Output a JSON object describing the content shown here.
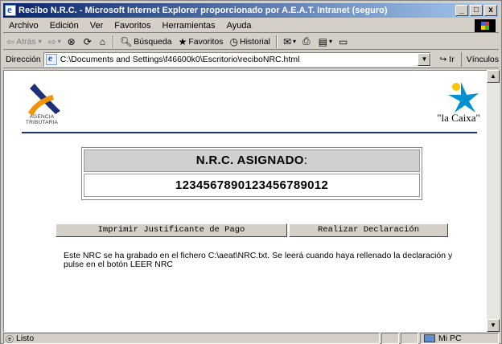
{
  "window": {
    "title": "Recibo N.R.C. - Microsoft Internet Explorer proporcionado por A.E.A.T.  Intranet (seguro)",
    "controls": [
      "_",
      "□",
      "x"
    ]
  },
  "menubar": {
    "items": [
      "Archivo",
      "Edición",
      "Ver",
      "Favoritos",
      "Herramientas",
      "Ayuda"
    ]
  },
  "toolbar": {
    "back": "Atrás",
    "search": "Búsqueda",
    "favorites": "Favoritos",
    "history": "Historial"
  },
  "addressbar": {
    "label": "Dirección",
    "url": "C:\\Documents and Settings\\f46600k0\\Escritorio\\reciboNRC.html",
    "go": "Ir",
    "links": "Vínculos"
  },
  "page": {
    "aeat_logo_text": "AGENCIA TRIBUTARIA",
    "caixa_logo_text": "\"la Caixa\"",
    "nrc_heading": "N.R.C. ASIGNADO",
    "nrc_heading_colon": ":",
    "nrc_value": "1234567890123456789012",
    "print_button": "Imprimir Justificante de Pago",
    "declaration_button": "Realizar Declaración",
    "message": "Este NRC se ha grabado en el fichero C:\\aeat\\NRC.txt. Se leerá cuando haya rellenado la declaración y pulse en el botón LEER NRC"
  },
  "statusbar": {
    "status": "Listo",
    "zone": "Mi PC"
  },
  "colors": {
    "title_gradient_start": "#0a246a",
    "title_gradient_end": "#a6caf0",
    "aeat_blue": "#1c2f78",
    "aeat_orange": "#f29400",
    "caixa_blue": "#0091d5",
    "caixa_red": "#e30613",
    "caixa_yellow": "#fdc300"
  }
}
